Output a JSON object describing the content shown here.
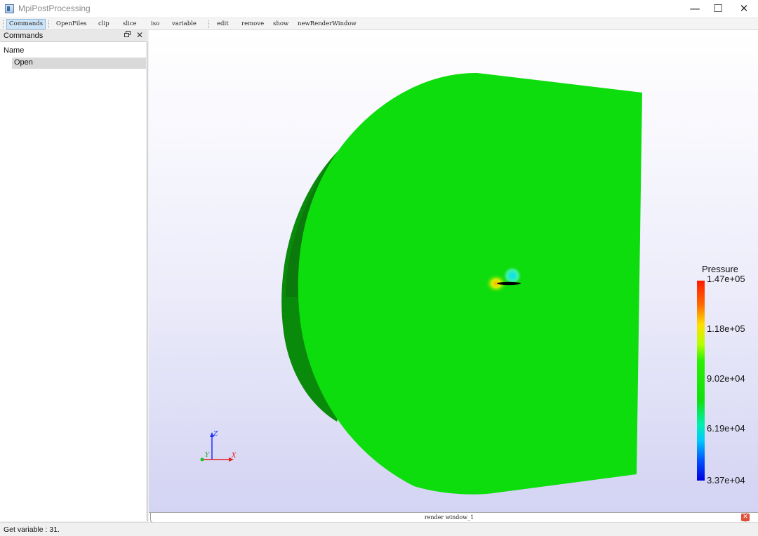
{
  "window": {
    "title": "MpiPostProcessing",
    "minimize": "—",
    "maximize": "☐",
    "close": "✕"
  },
  "toolbar": {
    "items": [
      {
        "label": "Commands",
        "active": true
      },
      {
        "label": "OpenFiles",
        "active": false
      },
      {
        "label": "clip",
        "active": false
      },
      {
        "label": "slice",
        "active": false
      },
      {
        "label": "iso",
        "active": false
      },
      {
        "label": "variable",
        "active": false
      },
      {
        "label": "edit",
        "active": false
      },
      {
        "label": "remove",
        "active": false
      },
      {
        "label": "show",
        "active": false
      },
      {
        "label": "newRenderWindow",
        "active": false
      }
    ]
  },
  "dock": {
    "title": "Commands",
    "float_icon": "float-icon",
    "close_icon": "close-icon",
    "tree": {
      "column_header": "Name",
      "items": [
        "Open"
      ]
    }
  },
  "render": {
    "surface_color": "#0ddc0d",
    "edge_color": "#0a7a0a",
    "orientation_axes": {
      "z": "Z",
      "y": "Y",
      "x": "X"
    },
    "scalar_bar": {
      "title": "Pressure",
      "labels": [
        "1.47e+05",
        "1.18e+05",
        "9.02e+04",
        "6.19e+04",
        "3.37e+04"
      ]
    }
  },
  "tab": {
    "label": "render window_1",
    "close": "✕"
  },
  "status": {
    "text": "Get variable : 31."
  }
}
